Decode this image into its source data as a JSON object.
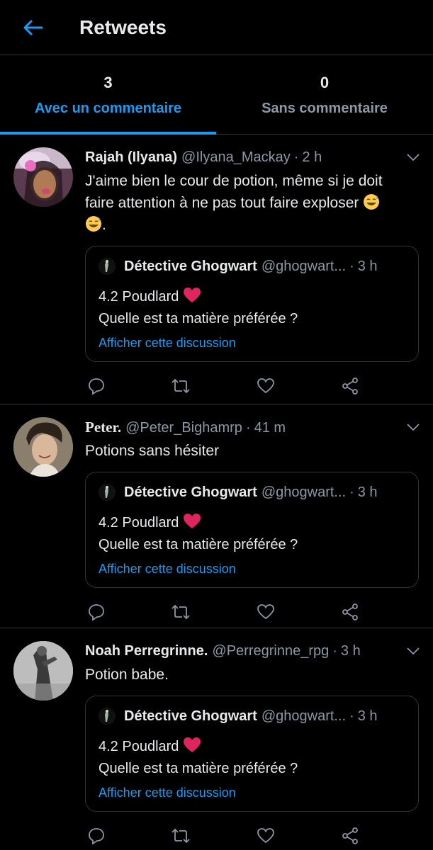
{
  "header": {
    "title": "Retweets"
  },
  "tabs": [
    {
      "count": "3",
      "label": "Avec un commentaire",
      "active": true
    },
    {
      "count": "0",
      "label": "Sans commentaire",
      "active": false
    }
  ],
  "colors": {
    "accent": "#1d9bf0",
    "background": "#000000",
    "muted": "#8b98a5",
    "heart": "#e0245e"
  },
  "tweets": [
    {
      "name": "Rajah (Ilyana)",
      "handle": "@Ilyana_Mackay",
      "time": "2 h",
      "text_part1": "J'aime bien le cour de potion, même si je doit faire attention à ne pas tout faire exploser",
      "text_part2": ".",
      "emoji": "sweat-smile",
      "quote": {
        "name": "Détective Ghogwart",
        "handle": "@ghogwart...",
        "time": "3 h",
        "line1": "4.2 Poudlard",
        "line2": "Quelle est ta matière préférée ?",
        "link": "Afficher cette discussion"
      }
    },
    {
      "name": "Peter.",
      "handle": "@Peter_Bighamrp",
      "time": "41 m",
      "text": "Potions sans hésiter",
      "quote": {
        "name": "Détective Ghogwart",
        "handle": "@ghogwart...",
        "time": "3 h",
        "line1": "4.2 Poudlard",
        "line2": "Quelle est ta matière préférée ?",
        "link": "Afficher cette discussion"
      }
    },
    {
      "name": "Noah Perregrinne.",
      "handle": "@Perregrinne_rpg",
      "time": "3 h",
      "text": "Potion babe.",
      "quote": {
        "name": "Détective Ghogwart",
        "handle": "@ghogwart...",
        "time": "3 h",
        "line1": "4.2 Poudlard",
        "line2": "Quelle est ta matière préférée ?",
        "link": "Afficher cette discussion"
      }
    }
  ]
}
